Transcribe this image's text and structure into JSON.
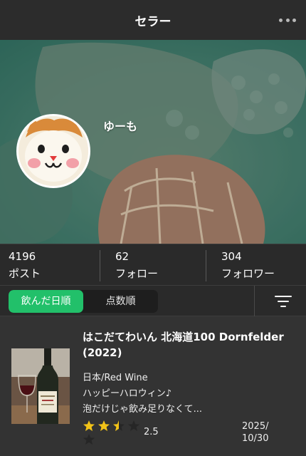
{
  "header": {
    "title": "セラー",
    "more_icon": "ellipsis-icon"
  },
  "profile": {
    "username": "ゆーも",
    "avatar_icon": "cat-character-avatar"
  },
  "stats": [
    {
      "value": "4196",
      "label": "ポスト"
    },
    {
      "value": "62",
      "label": "フォロー"
    },
    {
      "value": "304",
      "label": "フォロワー"
    }
  ],
  "sort": {
    "options": [
      "飲んだ日順",
      "点数順"
    ],
    "selected": "飲んだ日順",
    "filter_icon": "filter-icon"
  },
  "posts": [
    {
      "title": "はこだてわいん 北海道100 Dornfelder (2022)",
      "origin": "日本/Red Wine",
      "line1": "ハッピーハロウィン♪",
      "line2": "泡だけじゃ飲み足りなくて...",
      "rating": 2.5,
      "rating_text": "2.5",
      "date": "2025/10/30"
    }
  ],
  "colors": {
    "accent": "#22c06a",
    "star": "#f2c318",
    "star_empty": "#2a2a2a",
    "background": "#333333"
  }
}
